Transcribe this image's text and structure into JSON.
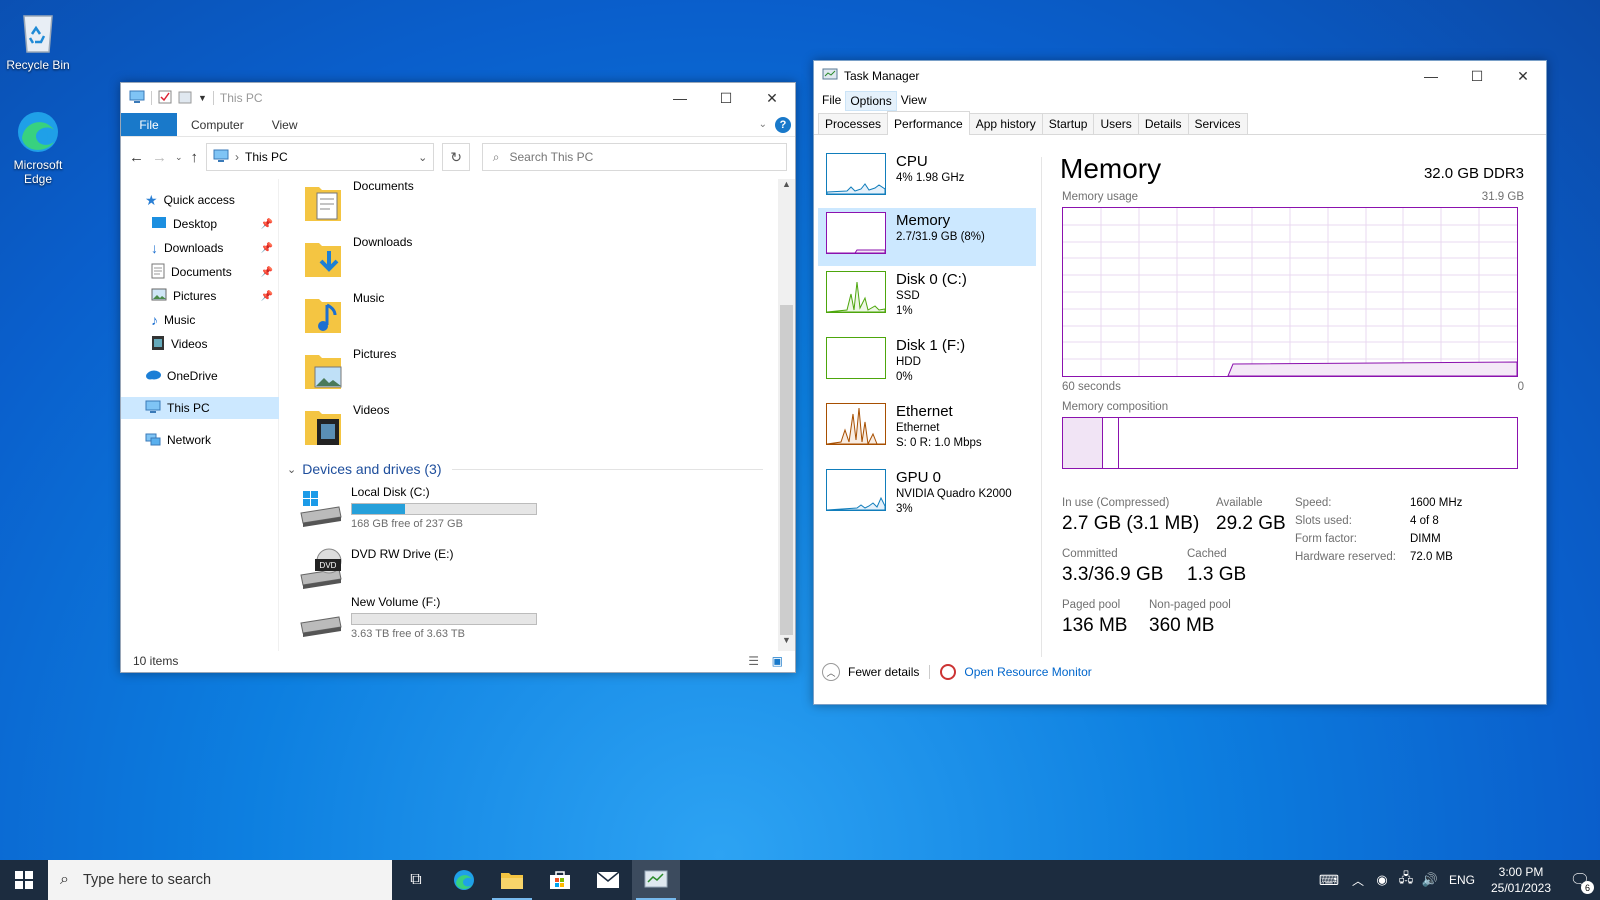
{
  "desktop": {
    "icons": [
      {
        "label": "Recycle Bin"
      },
      {
        "label": "Microsoft Edge"
      }
    ]
  },
  "explorer": {
    "title": "This PC",
    "ribbon": {
      "file": "File",
      "computer": "Computer",
      "view": "View"
    },
    "address": "This PC",
    "search_placeholder": "Search This PC",
    "nav": [
      {
        "label": "Quick access"
      },
      {
        "label": "Desktop"
      },
      {
        "label": "Downloads"
      },
      {
        "label": "Documents"
      },
      {
        "label": "Pictures"
      },
      {
        "label": "Music"
      },
      {
        "label": "Videos"
      },
      {
        "label": "OneDrive"
      },
      {
        "label": "This PC"
      },
      {
        "label": "Network"
      }
    ],
    "folders": [
      {
        "label": "Documents"
      },
      {
        "label": "Downloads"
      },
      {
        "label": "Music"
      },
      {
        "label": "Pictures"
      },
      {
        "label": "Videos"
      }
    ],
    "devices_header": "Devices and drives (3)",
    "drives": [
      {
        "label": "Local Disk (C:)",
        "free": "168 GB free of 237 GB",
        "used_fraction": 0.29
      },
      {
        "label": "DVD RW Drive (E:)"
      },
      {
        "label": "New Volume (F:)",
        "free": "3.63 TB free of 3.63 TB",
        "used_fraction": 0.0
      }
    ],
    "status": "10 items",
    "accent": "#1979ca"
  },
  "taskmgr": {
    "title": "Task Manager",
    "menu": {
      "file": "File",
      "options": "Options",
      "view": "View"
    },
    "tabs": [
      "Processes",
      "Performance",
      "App history",
      "Startup",
      "Users",
      "Details",
      "Services"
    ],
    "side": [
      {
        "name": "CPU",
        "l2": "4% 1.98 GHz",
        "l3": ""
      },
      {
        "name": "Memory",
        "l2": "2.7/31.9 GB (8%)",
        "l3": ""
      },
      {
        "name": "Disk 0 (C:)",
        "l2": "SSD",
        "l3": "1%"
      },
      {
        "name": "Disk 1 (F:)",
        "l2": "HDD",
        "l3": "0%"
      },
      {
        "name": "Ethernet",
        "l2": "Ethernet",
        "l3": "S: 0 R: 1.0 Mbps"
      },
      {
        "name": "GPU 0",
        "l2": "NVIDIA Quadro K2000",
        "l3": "3%"
      }
    ],
    "main": {
      "heading": "Memory",
      "total": "32.0 GB DDR3",
      "usage_label": "Memory usage",
      "usage_max": "31.9 GB",
      "time_left": "60 seconds",
      "time_right": "0",
      "composition_label": "Memory composition",
      "stats": {
        "in_use_label": "In use (Compressed)",
        "in_use": "2.7 GB (3.1 MB)",
        "available_label": "Available",
        "available": "29.2 GB",
        "committed_label": "Committed",
        "committed": "3.3/36.9 GB",
        "cached_label": "Cached",
        "cached": "1.3 GB",
        "paged_label": "Paged pool",
        "paged": "136 MB",
        "nonpaged_label": "Non-paged pool",
        "nonpaged": "360 MB"
      },
      "specs": [
        {
          "k": "Speed:",
          "v": "1600 MHz"
        },
        {
          "k": "Slots used:",
          "v": "4 of 8"
        },
        {
          "k": "Form factor:",
          "v": "DIMM"
        },
        {
          "k": "Hardware reserved:",
          "v": "72.0 MB"
        }
      ]
    },
    "footer": {
      "fewer": "Fewer details",
      "monitor": "Open Resource Monitor"
    },
    "colors": {
      "memory": "#8b12ae",
      "cpu": "#117dbb",
      "disk": "#4da60c",
      "ethernet": "#a74f01"
    }
  },
  "taskbar": {
    "search_placeholder": "Type here to search",
    "lang": "ENG",
    "time": "3:00 PM",
    "date": "25/01/2023",
    "notifications": "6"
  }
}
